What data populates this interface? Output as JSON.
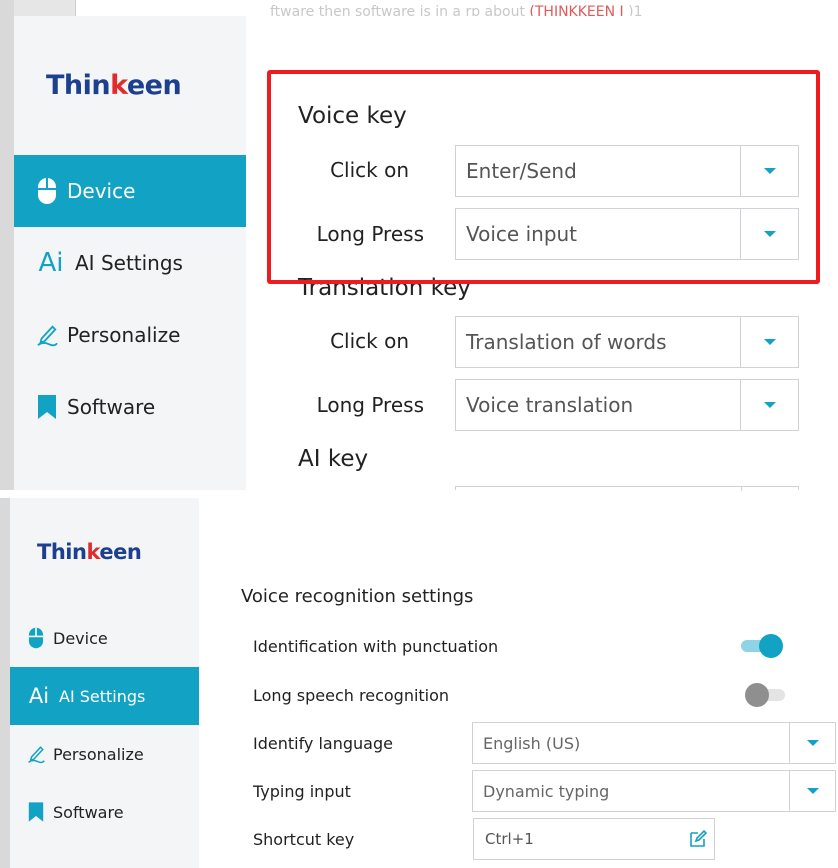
{
  "top": {
    "doc_text_a": "ftware then software is in a rp  about",
    "doc_text_red": "(THINKKEEN I",
    "doc_text_b": ")1",
    "logo": {
      "pre": "Thin",
      "k": "k",
      "post": "een"
    },
    "nav": [
      {
        "label": "Device",
        "icon": "mouse-icon",
        "active": true
      },
      {
        "label": "AI Settings",
        "icon": "ai-icon",
        "active": false
      },
      {
        "label": "Personalize",
        "icon": "pen-icon",
        "active": false
      },
      {
        "label": "Software",
        "icon": "bookmark-icon",
        "active": false
      }
    ],
    "ai_icon_text": "Ai",
    "voice_key": {
      "title": "Voice key",
      "click_label": "Click on",
      "click_value": "Enter/Send",
      "long_label": "Long Press",
      "long_value": "Voice input"
    },
    "translation_key": {
      "title": "Translation key",
      "click_label": "Click on",
      "click_value": "Translation of words",
      "long_label": "Long Press",
      "long_value": "Voice translation"
    },
    "ai_key": {
      "title": "AI key"
    }
  },
  "bottom": {
    "logo": {
      "pre": "Thin",
      "k": "k",
      "post": "een"
    },
    "nav": [
      {
        "label": "Device",
        "icon": "mouse-icon",
        "active": false
      },
      {
        "label": "AI Settings",
        "icon": "ai-icon",
        "active": true
      },
      {
        "label": "Personalize",
        "icon": "pen-icon",
        "active": false
      },
      {
        "label": "Software",
        "icon": "bookmark-icon",
        "active": false
      }
    ],
    "ai_icon_text": "Ai",
    "section_title": "Voice recognition settings",
    "punctuation": {
      "label": "Identification with punctuation",
      "enabled": true
    },
    "long_speech": {
      "label": "Long speech recognition",
      "enabled": false
    },
    "identify_language": {
      "label": "Identify language",
      "value": "English (US)"
    },
    "typing_input": {
      "label": "Typing input",
      "value": "Dynamic typing"
    },
    "shortcut": {
      "label": "Shortcut key",
      "value": "Ctrl+1"
    }
  },
  "colors": {
    "accent": "#12a3c4",
    "highlight": "#ee1c1c",
    "logo_blue": "#1c3f8e",
    "logo_red": "#e22c2c"
  }
}
